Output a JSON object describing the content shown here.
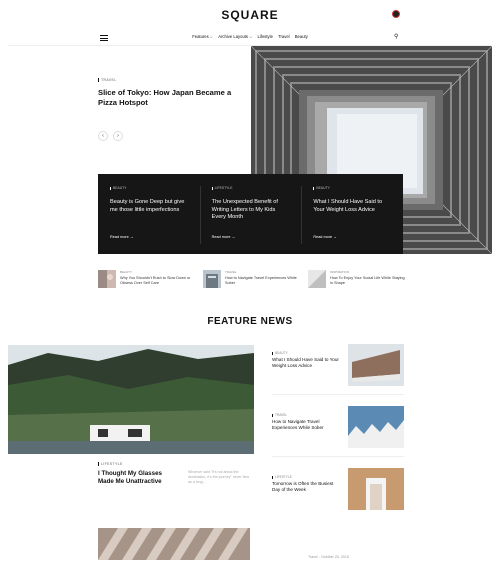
{
  "header": {
    "logo": "SQUARE",
    "nav": [
      "Features ⌵",
      "Archive Layouts ⌵",
      "Lifestyle",
      "Travel",
      "Beauty"
    ]
  },
  "hero": {
    "category": "TRAVEL",
    "title": "Slice of Tokyo: How Japan Became a Pizza Hotspot",
    "prev": "‹",
    "next": "›"
  },
  "dark_box": [
    {
      "category": "BEAUTY",
      "title": "Beauty is Gone Deep but give me those little imperfections",
      "more": "Read more →"
    },
    {
      "category": "LIFESTYLE",
      "title": "The Unexpected Benefit of Writing Letters to My Kids Every Month",
      "more": "Read more →"
    },
    {
      "category": "BEAUTY",
      "title": "What I Should Have Said to Your Weight Loss Advice",
      "more": "Read more →"
    }
  ],
  "mini_posts": [
    {
      "category": "BEAUTY",
      "title": "Why You Shouldn't Rush to Slow Down or Obsess Over Self Care"
    },
    {
      "category": "TRAVEL",
      "title": "How to Navigate Travel Experiences While Sober"
    },
    {
      "category": "INSPIRATION",
      "title": "How To Enjoy Your Social Life While Staying in Shape"
    }
  ],
  "feature_news": {
    "section_title": "FEATURE NEWS",
    "main": {
      "category": "LIFESTYLE",
      "title": "I Thought My Glasses Made Me Unattractive",
      "excerpt": "Whoever said \"it's not about the destination, it's the journey\" never flew as a long..."
    },
    "side": [
      {
        "category": "BEAUTY",
        "title": "What I Should Have Said to Your Weight Loss Advice"
      },
      {
        "category": "TRAVEL",
        "title": "How to Navigate Travel Experiences While Sober"
      },
      {
        "category": "LIFESTYLE",
        "title": "Tomorrow is Often the Busiest Day of the Week"
      }
    ],
    "bottom_meta": "Travel  -  October 20, 2015"
  },
  "colors": {
    "dark_box_bg": "#161616",
    "accent": "#111111"
  }
}
